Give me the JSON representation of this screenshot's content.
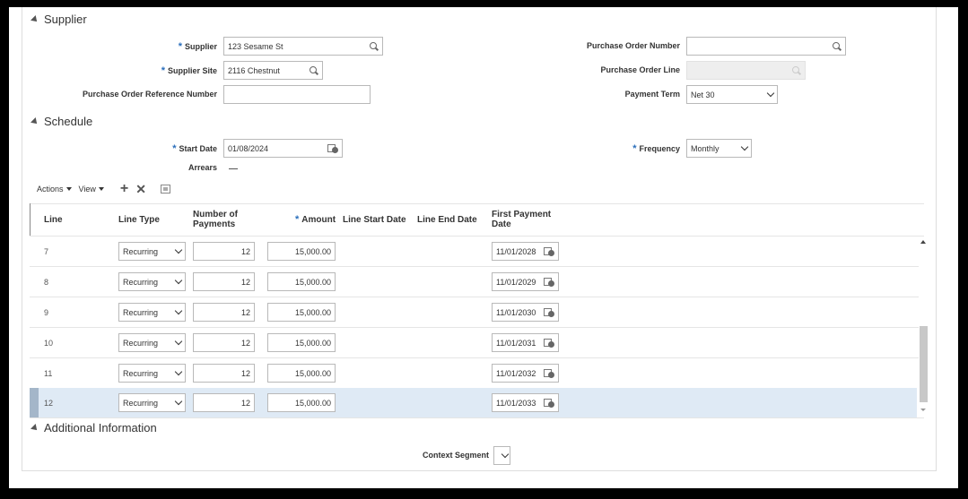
{
  "supplier_section": {
    "title": "Supplier",
    "supplier_label": "Supplier",
    "supplier_value": "123 Sesame St",
    "supplier_site_label": "Supplier Site",
    "supplier_site_value": "2116 Chestnut",
    "po_ref_label": "Purchase Order Reference Number",
    "po_ref_value": "",
    "po_number_label": "Purchase Order Number",
    "po_number_value": "",
    "po_line_label": "Purchase Order Line",
    "po_line_value": "",
    "payment_term_label": "Payment Term",
    "payment_term_value": "Net 30"
  },
  "schedule_section": {
    "title": "Schedule",
    "start_date_label": "Start Date",
    "start_date_value": "01/08/2024",
    "arrears_label": "Arrears",
    "frequency_label": "Frequency",
    "frequency_value": "Monthly"
  },
  "toolbar": {
    "actions_label": "Actions",
    "view_label": "View"
  },
  "table": {
    "headers": {
      "line": "Line",
      "line_type": "Line Type",
      "num_payments_1": "Number of",
      "num_payments_2": "Payments",
      "amount": "Amount",
      "line_start": "Line Start Date",
      "line_end": "Line End Date",
      "first_payment_1": "First Payment",
      "first_payment_2": "Date"
    },
    "rows": [
      {
        "line": "7",
        "type": "Recurring",
        "payments": "12",
        "amount": "15,000.00",
        "first_date": "11/01/2028"
      },
      {
        "line": "8",
        "type": "Recurring",
        "payments": "12",
        "amount": "15,000.00",
        "first_date": "11/01/2029"
      },
      {
        "line": "9",
        "type": "Recurring",
        "payments": "12",
        "amount": "15,000.00",
        "first_date": "11/01/2030"
      },
      {
        "line": "10",
        "type": "Recurring",
        "payments": "12",
        "amount": "15,000.00",
        "first_date": "11/01/2031"
      },
      {
        "line": "11",
        "type": "Recurring",
        "payments": "12",
        "amount": "15,000.00",
        "first_date": "11/01/2032"
      },
      {
        "line": "12",
        "type": "Recurring",
        "payments": "12",
        "amount": "15,000.00",
        "first_date": "11/01/2033"
      }
    ],
    "selected_row": "12"
  },
  "additional_section": {
    "title": "Additional Information",
    "context_segment_label": "Context Segment",
    "context_segment_value": ""
  },
  "colors": {
    "required_marker": "#2a6ebb",
    "selected_row": "#dfeaf5"
  }
}
